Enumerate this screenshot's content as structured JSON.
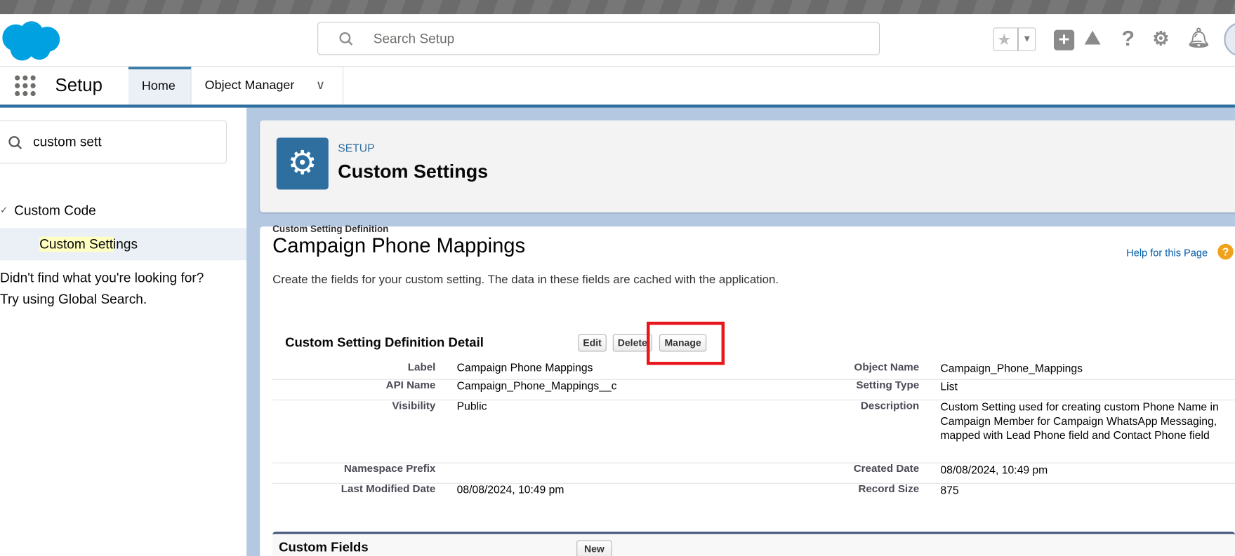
{
  "header": {
    "search_placeholder": "Search Setup"
  },
  "nav": {
    "app_name": "Setup",
    "tabs": [
      {
        "label": "Home",
        "active": true
      },
      {
        "label": "Object Manager"
      }
    ]
  },
  "sidebar": {
    "search_value": "custom sett",
    "group": "Custom Code",
    "item_highlight": "Custom Sett",
    "item_rest": "ings",
    "not_found_1": "Didn't find what you're looking for?",
    "not_found_2": "Try using Global Search."
  },
  "page_header": {
    "eyebrow": "SETUP",
    "title": "Custom Settings"
  },
  "content": {
    "subtitle": "Custom Setting Definition",
    "title": "Campaign Phone Mappings",
    "help": "Help for this Page",
    "description": "Create the fields for your custom setting. The data in these fields are cached with the application.",
    "detail_title": "Custom Setting Definition Detail",
    "buttons": {
      "edit": "Edit",
      "delete": "Delete",
      "manage": "Manage"
    },
    "fields_left": [
      {
        "label": "Label",
        "value": "Campaign Phone Mappings"
      },
      {
        "label": "API Name",
        "value": "Campaign_Phone_Mappings__c"
      },
      {
        "label": "Visibility",
        "value": "Public"
      },
      {
        "label": "Namespace Prefix",
        "value": ""
      },
      {
        "label": "Last Modified Date",
        "value": "08/08/2024, 10:49 pm"
      }
    ],
    "fields_right": [
      {
        "label": "Object Name",
        "value": "Campaign_Phone_Mappings"
      },
      {
        "label": "Setting Type",
        "value": "List"
      },
      {
        "label": "Description",
        "value": "Custom Setting used for creating custom Phone Name in Campaign Member for Campaign WhatsApp Messaging, mapped with Lead Phone field and Contact Phone field"
      },
      {
        "label": "Created Date",
        "value": "08/08/2024, 10:49 pm"
      },
      {
        "label": "Record Size",
        "value": "875"
      }
    ],
    "custom_fields_title": "Custom Fields",
    "new_button": "New"
  },
  "colors": {
    "brand": "#00a1e0",
    "accent": "#2e6fa0",
    "highlight_box": "#e8161c"
  }
}
